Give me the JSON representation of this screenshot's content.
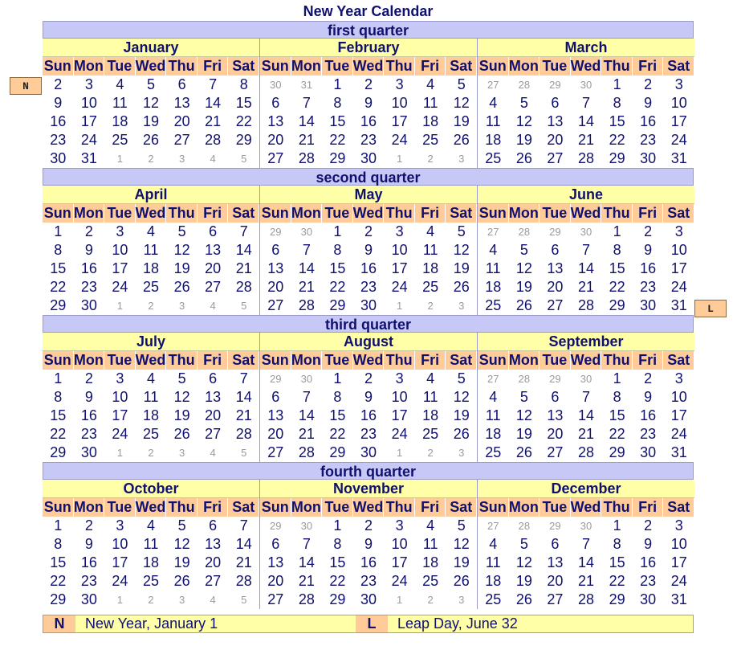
{
  "title": "New Year Calendar",
  "weekdays": [
    "Sun",
    "Mon",
    "Tue",
    "Wed",
    "Thu",
    "Fri",
    "Sat"
  ],
  "quarters": [
    {
      "label": "first quarter",
      "months": [
        "January",
        "February",
        "March"
      ]
    },
    {
      "label": "second quarter",
      "months": [
        "April",
        "May",
        "June"
      ]
    },
    {
      "label": "third quarter",
      "months": [
        "July",
        "August",
        "September"
      ]
    },
    {
      "label": "fourth quarter",
      "months": [
        "October",
        "November",
        "December"
      ]
    }
  ],
  "templates": [
    [
      [
        [
          1,
          2,
          3,
          4,
          5,
          6,
          7,
          8
        ],
        0
      ],
      [
        9,
        10,
        11,
        12,
        13,
        14,
        15
      ],
      [
        16,
        17,
        18,
        19,
        20,
        21,
        22
      ],
      [
        23,
        24,
        25,
        26,
        27,
        28,
        29
      ],
      [
        30,
        31,
        "o1",
        "o2",
        "o3",
        "o4",
        "o5"
      ]
    ],
    [
      [
        "o30",
        "o31",
        1,
        2,
        3,
        4,
        5
      ],
      [
        6,
        7,
        8,
        9,
        10,
        11,
        12
      ],
      [
        13,
        14,
        15,
        16,
        17,
        18,
        19
      ],
      [
        20,
        21,
        22,
        23,
        24,
        25,
        26
      ],
      [
        27,
        28,
        29,
        30,
        "o1",
        "o2",
        "o3"
      ]
    ],
    [
      [
        "o27",
        "o28",
        "o29",
        "o30",
        1,
        2,
        3
      ],
      [
        4,
        5,
        6,
        7,
        8,
        9,
        10
      ],
      [
        11,
        12,
        13,
        14,
        15,
        16,
        17
      ],
      [
        18,
        19,
        20,
        21,
        22,
        23,
        24
      ],
      [
        25,
        26,
        27,
        28,
        29,
        30,
        31
      ]
    ]
  ],
  "markers": {
    "new_year": {
      "key": "N",
      "text": "New Year, January 1"
    },
    "leap_day": {
      "key": "L",
      "text": "Leap Day, June 32"
    }
  },
  "colors": {
    "quarter_header": "#c8c8f6",
    "month_header": "#ffffa8",
    "weekday_header": "#ffcc99",
    "marker": "#ffcc99"
  }
}
